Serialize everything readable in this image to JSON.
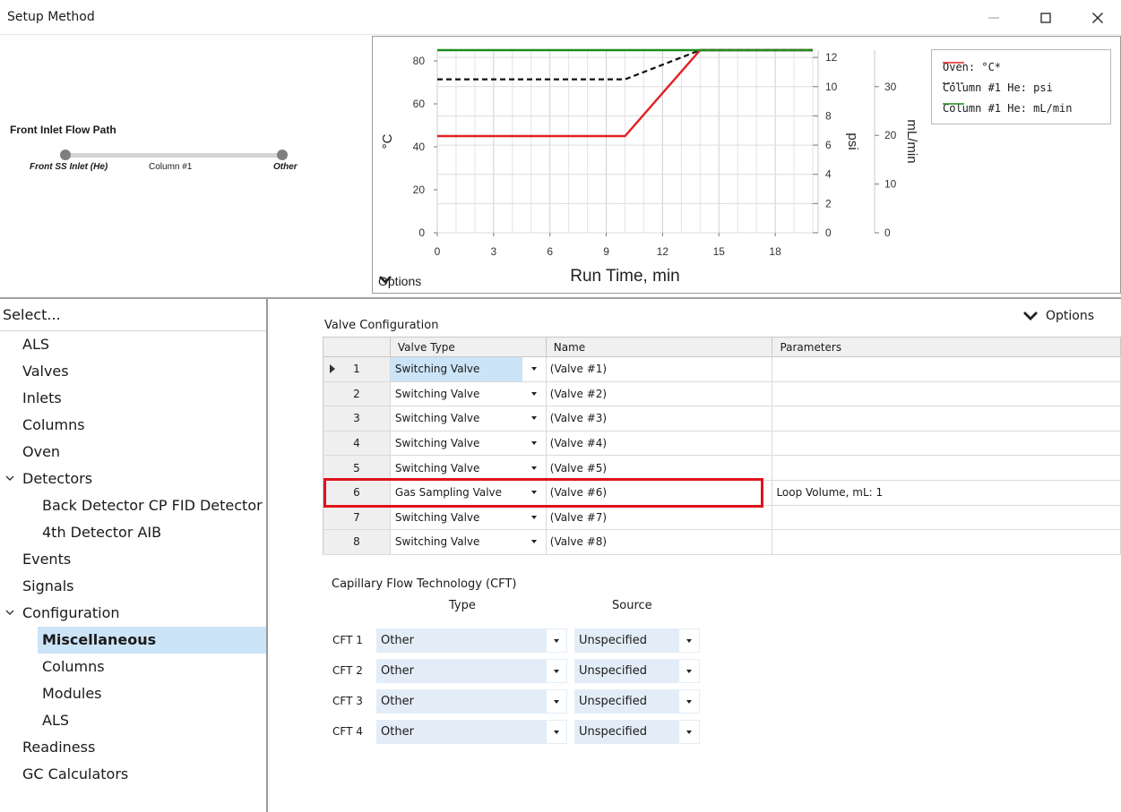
{
  "window": {
    "title": "Setup Method"
  },
  "flow_path": {
    "title": "Front Inlet Flow Path",
    "left_label": "Front SS Inlet (He)",
    "middle_label": "Column #1",
    "right_label": "Other"
  },
  "chart_data": {
    "type": "line",
    "xlabel": "Run Time, min",
    "x_ticks": [
      0,
      3,
      6,
      9,
      12,
      15,
      18
    ],
    "xlim": [
      0,
      20
    ],
    "axes": [
      {
        "label": "°C",
        "ticks": [
          0,
          20,
          40,
          60,
          80
        ],
        "ylim": [
          0,
          85
        ]
      },
      {
        "label": "psi",
        "ticks": [
          0,
          2,
          4,
          6,
          8,
          10,
          12
        ],
        "ylim": [
          0,
          12.5
        ]
      },
      {
        "label": "mL/min",
        "ticks": [
          0,
          10,
          20,
          30
        ],
        "ylim": [
          0,
          37.5
        ]
      }
    ],
    "series": [
      {
        "name": "Oven: °C*",
        "axis": 0,
        "color": "#e02020",
        "dash": "solid",
        "x": [
          0,
          10,
          14,
          20
        ],
        "y": [
          45,
          45,
          85,
          85
        ]
      },
      {
        "name": "Column #1 He: psi",
        "axis": 1,
        "color": "#111111",
        "dash": "dashed",
        "x": [
          0,
          10,
          14,
          20
        ],
        "y": [
          10.5,
          10.5,
          12.5,
          12.5
        ]
      },
      {
        "name": "Column #1 He: mL/min",
        "axis": 2,
        "color": "#1e8c1e",
        "dash": "solid",
        "x": [
          0,
          20
        ],
        "y": [
          37.5,
          37.5
        ]
      }
    ],
    "grid": true,
    "legend": "top-right",
    "options_label": "Options"
  },
  "sidebar": {
    "header": "Select...",
    "items": [
      {
        "label": "ALS",
        "indent": 0
      },
      {
        "label": "Valves",
        "indent": 0
      },
      {
        "label": "Inlets",
        "indent": 0
      },
      {
        "label": "Columns",
        "indent": 0
      },
      {
        "label": "Oven",
        "indent": 0
      },
      {
        "label": "Detectors",
        "indent": 0,
        "expanded": true
      },
      {
        "label": "Back Detector CP FID Detector",
        "indent": 1
      },
      {
        "label": "4th Detector AIB",
        "indent": 1
      },
      {
        "label": "Events",
        "indent": 0
      },
      {
        "label": "Signals",
        "indent": 0
      },
      {
        "label": "Configuration",
        "indent": 0,
        "expanded": true
      },
      {
        "label": "Miscellaneous",
        "indent": 1,
        "selected": true
      },
      {
        "label": "Columns",
        "indent": 1
      },
      {
        "label": "Modules",
        "indent": 1
      },
      {
        "label": "ALS",
        "indent": 1
      },
      {
        "label": "Readiness",
        "indent": 0
      },
      {
        "label": "GC Calculators",
        "indent": 0
      }
    ]
  },
  "valve_config": {
    "title": "Valve Configuration",
    "options_label": "Options",
    "columns": [
      "Valve Type",
      "Name",
      "Parameters"
    ],
    "rows": [
      {
        "num": "1",
        "type": "Switching Valve",
        "name": "(Valve #1)",
        "params": "",
        "current": true
      },
      {
        "num": "2",
        "type": "Switching Valve",
        "name": "(Valve #2)",
        "params": ""
      },
      {
        "num": "3",
        "type": "Switching Valve",
        "name": "(Valve #3)",
        "params": ""
      },
      {
        "num": "4",
        "type": "Switching Valve",
        "name": "(Valve #4)",
        "params": ""
      },
      {
        "num": "5",
        "type": "Switching Valve",
        "name": "(Valve #5)",
        "params": ""
      },
      {
        "num": "6",
        "type": "Gas Sampling Valve",
        "name": "(Valve #6)",
        "params": "Loop Volume, mL: 1",
        "highlighted": true
      },
      {
        "num": "7",
        "type": "Switching Valve",
        "name": "(Valve #7)",
        "params": ""
      },
      {
        "num": "8",
        "type": "Switching Valve",
        "name": "(Valve #8)",
        "params": ""
      }
    ]
  },
  "cft": {
    "title": "Capillary Flow Technology (CFT)",
    "type_header": "Type",
    "source_header": "Source",
    "rows": [
      {
        "label": "CFT 1",
        "type": "Other",
        "source": "Unspecified"
      },
      {
        "label": "CFT 2",
        "type": "Other",
        "source": "Unspecified"
      },
      {
        "label": "CFT 3",
        "type": "Other",
        "source": "Unspecified"
      },
      {
        "label": "CFT 4",
        "type": "Other",
        "source": "Unspecified"
      }
    ]
  }
}
